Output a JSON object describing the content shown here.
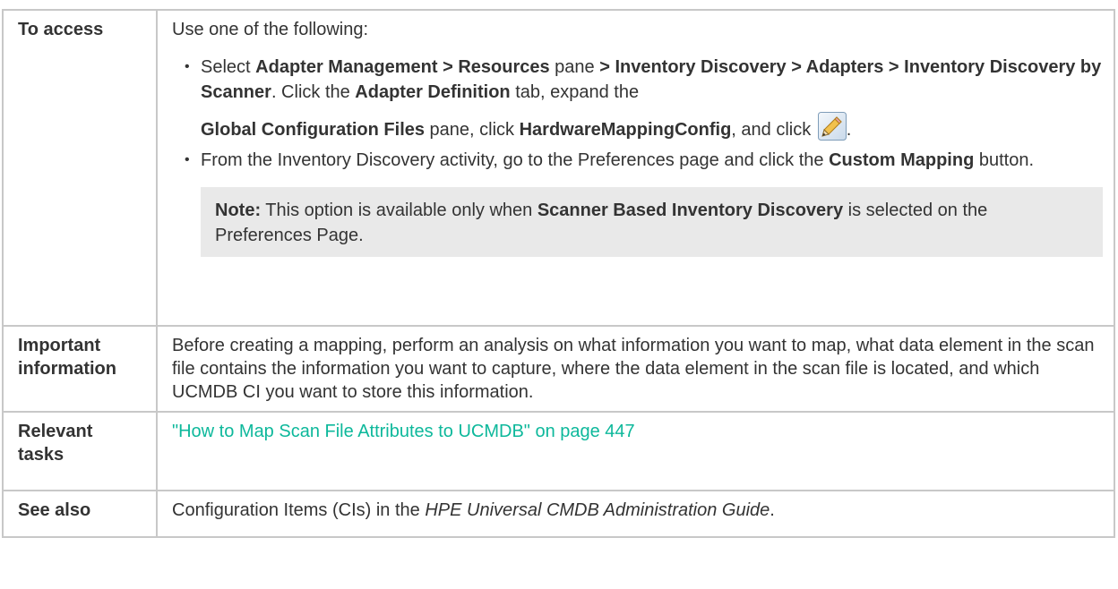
{
  "rows": {
    "access": {
      "label": "To access",
      "intro": "Use one of the following:",
      "item1": {
        "p1": "Select ",
        "b1": "Adapter Management > Resources",
        "p2": " pane ",
        "b2": "> Inventory Discovery > Adapters > Inventory Discovery by Scanner",
        "p3": ". Click the ",
        "b3": "Adapter Definition",
        "p4": " tab, expand the ",
        "b4": "Global Configuration Files",
        "p5": " pane, click ",
        "b5": "HardwareMappingConfig",
        "p6": ", and click ",
        "icon": "edit-pencil-icon",
        "p7": "."
      },
      "item2": {
        "p1": "From the Inventory Discovery activity, go to the Preferences page and click the ",
        "b1": "Custom Mapping",
        "p2": " button."
      },
      "note": {
        "label": "Note:",
        "p1": " This option is available only when ",
        "b1": "Scanner Based Inventory Discovery",
        "p2": " is selected on the Preferences Page."
      }
    },
    "important": {
      "label_line1": "Important",
      "label_line2": "information",
      "text": "Before creating a mapping, perform an analysis on what information you want to map, what data element in the scan file contains the information you want to capture, where the data element in the scan file is located, and which UCMDB CI you want to store this information."
    },
    "relevant": {
      "label_line1": "Relevant",
      "label_line2": "tasks",
      "link": "\"How to Map Scan File Attributes to UCMDB\" on page 447"
    },
    "see_also": {
      "label": "See also",
      "p1": "Configuration Items (CIs) in the ",
      "i1": "HPE Universal CMDB Administration Guide",
      "p2": "."
    }
  },
  "colors": {
    "border": "#c8c8c8",
    "link": "#0db89b",
    "note_bg": "#e9e9e9",
    "text": "#333333"
  }
}
